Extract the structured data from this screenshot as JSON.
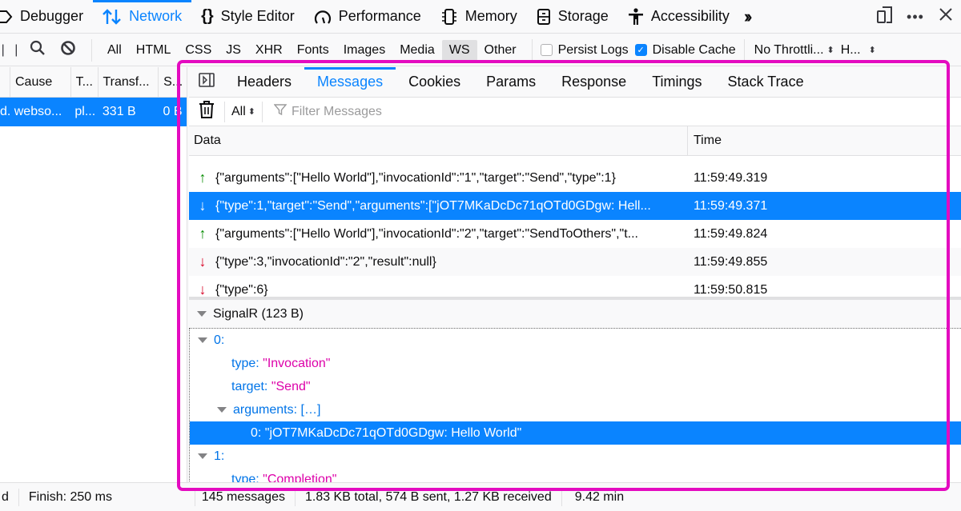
{
  "toolbar": {
    "tabs": [
      {
        "label": "Debugger",
        "icon": "debugger-icon"
      },
      {
        "label": "Network",
        "icon": "network-arrows-icon",
        "active": true
      },
      {
        "label": "Style Editor",
        "icon": "braces-icon"
      },
      {
        "label": "Performance",
        "icon": "gauge-icon"
      },
      {
        "label": "Memory",
        "icon": "chip-icon"
      },
      {
        "label": "Storage",
        "icon": "cabinet-icon"
      },
      {
        "label": "Accessibility",
        "icon": "person-icon"
      }
    ],
    "overflow_icon": "chevrons-right-icon",
    "right_icons": [
      "responsive-design-icon",
      "more-icon",
      "close-icon"
    ]
  },
  "filterbar": {
    "type_filters": [
      "All",
      "HTML",
      "CSS",
      "JS",
      "XHR",
      "Fonts",
      "Images",
      "Media",
      "WS",
      "Other"
    ],
    "active_filter": "WS",
    "persist_logs": {
      "label": "Persist Logs",
      "checked": false
    },
    "disable_cache": {
      "label": "Disable Cache",
      "checked": true
    },
    "throttling": "No Throttli...",
    "har": "H..."
  },
  "requests": {
    "columns": [
      "Cause",
      "T...",
      "Transf...",
      "S..."
    ],
    "rows": [
      {
        "prefix": "d...",
        "cause": "webso...",
        "type": "pl...",
        "transferred": "331 B",
        "size": "0 B",
        "selected": true
      }
    ]
  },
  "details": {
    "tabs": [
      "Headers",
      "Messages",
      "Cookies",
      "Params",
      "Response",
      "Timings",
      "Stack Trace"
    ],
    "active_tab": "Messages",
    "messages_toolbar": {
      "filter_select": "All",
      "filter_placeholder": "Filter Messages"
    },
    "columns": {
      "data": "Data",
      "time": "Time"
    },
    "messages": [
      {
        "direction": "sent",
        "data": "{\"arguments\":[\"Hello World\"],\"invocationId\":\"1\",\"target\":\"Send\",\"type\":1}",
        "time": "11:59:49.319",
        "selected": false
      },
      {
        "direction": "received",
        "data": "{\"type\":1,\"target\":\"Send\",\"arguments\":[\"jOT7MKaDcDc71qOTd0GDgw: Hell...",
        "time": "11:59:49.371",
        "selected": true
      },
      {
        "direction": "sent",
        "data": "{\"arguments\":[\"Hello World\"],\"invocationId\":\"2\",\"target\":\"SendToOthers\",\"t...",
        "time": "11:59:49.824",
        "selected": false
      },
      {
        "direction": "received",
        "data": "{\"type\":3,\"invocationId\":\"2\",\"result\":null}",
        "time": "11:59:49.855",
        "selected": false
      },
      {
        "direction": "received",
        "data": "{\"type\":6}",
        "time": "11:59:50.815",
        "selected": false
      }
    ],
    "payload": {
      "header": "SignalR (123 B)",
      "tree": [
        {
          "level": 0,
          "expandable": true,
          "key": "0:",
          "value": ""
        },
        {
          "level": 1,
          "expandable": false,
          "key": "type:",
          "value": "\"Invocation\""
        },
        {
          "level": 1,
          "expandable": false,
          "key": "target:",
          "value": "\"Send\""
        },
        {
          "level": 1,
          "expandable": true,
          "key": "arguments:",
          "value": "[…]"
        },
        {
          "level": 2,
          "expandable": false,
          "key": "0:",
          "value": "\"jOT7MKaDcDc71qOTd0GDgw: Hello World\"",
          "selected": true
        },
        {
          "level": 0,
          "expandable": true,
          "key": "1:",
          "value": ""
        },
        {
          "level": 1,
          "expandable": false,
          "key": "type:",
          "value": "\"Completion\""
        }
      ]
    }
  },
  "statusbar": {
    "left_partial": "d",
    "finish": "Finish: 250 ms",
    "messages_count": "145 messages",
    "totals": "1.83 KB total, 574 B sent, 1.27 KB received",
    "duration": "9.42 min"
  },
  "colors": {
    "accent": "#0a84ff",
    "sent_arrow": "#058b00",
    "received_arrow": "#d70022",
    "highlight_frame": "#e40bc0",
    "json_key": "#0074e8",
    "json_string": "#dd00a9"
  }
}
